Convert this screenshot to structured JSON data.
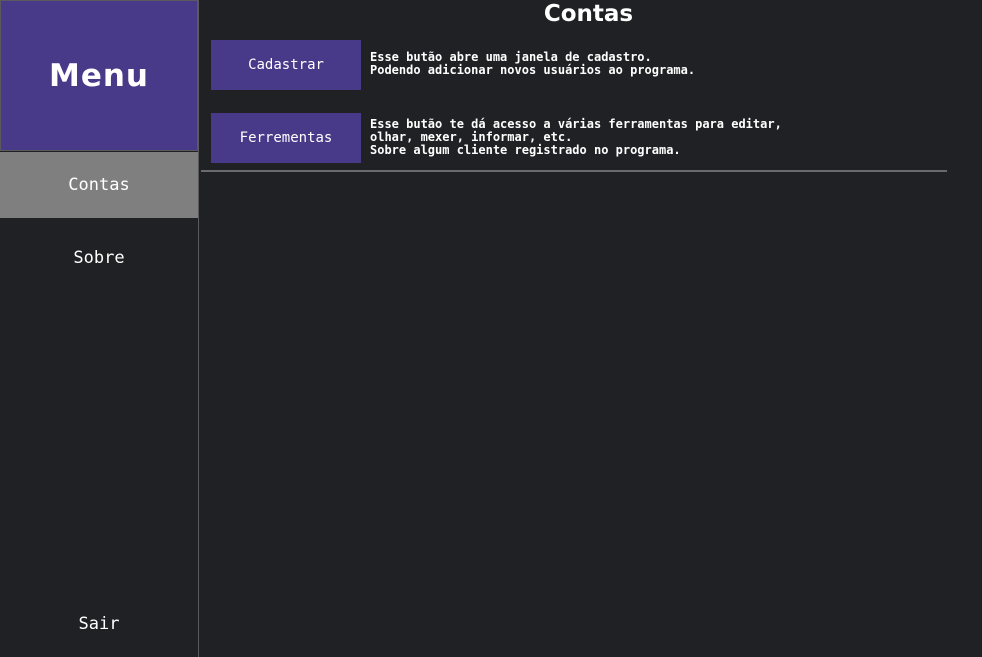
{
  "sidebar": {
    "title": "Menu",
    "items": [
      {
        "label": "Contas",
        "active": true
      },
      {
        "label": "Sobre",
        "active": false
      }
    ],
    "exit_label": "Sair"
  },
  "main": {
    "title": "Contas",
    "actions": [
      {
        "button_label": "Cadastrar",
        "description": "Esse butão abre uma janela de cadastro.\nPodendo adicionar novos usuários ao programa."
      },
      {
        "button_label": "Ferrementas",
        "description": "Esse butão te dá acesso a várias ferramentas para editar,\nolhar, mexer, informar, etc.\nSobre algum cliente registrado no programa."
      }
    ]
  },
  "colors": {
    "background": "#202124",
    "accent": "#483a89",
    "active_nav": "#7f7f80",
    "divider": "#6a6a6e"
  }
}
